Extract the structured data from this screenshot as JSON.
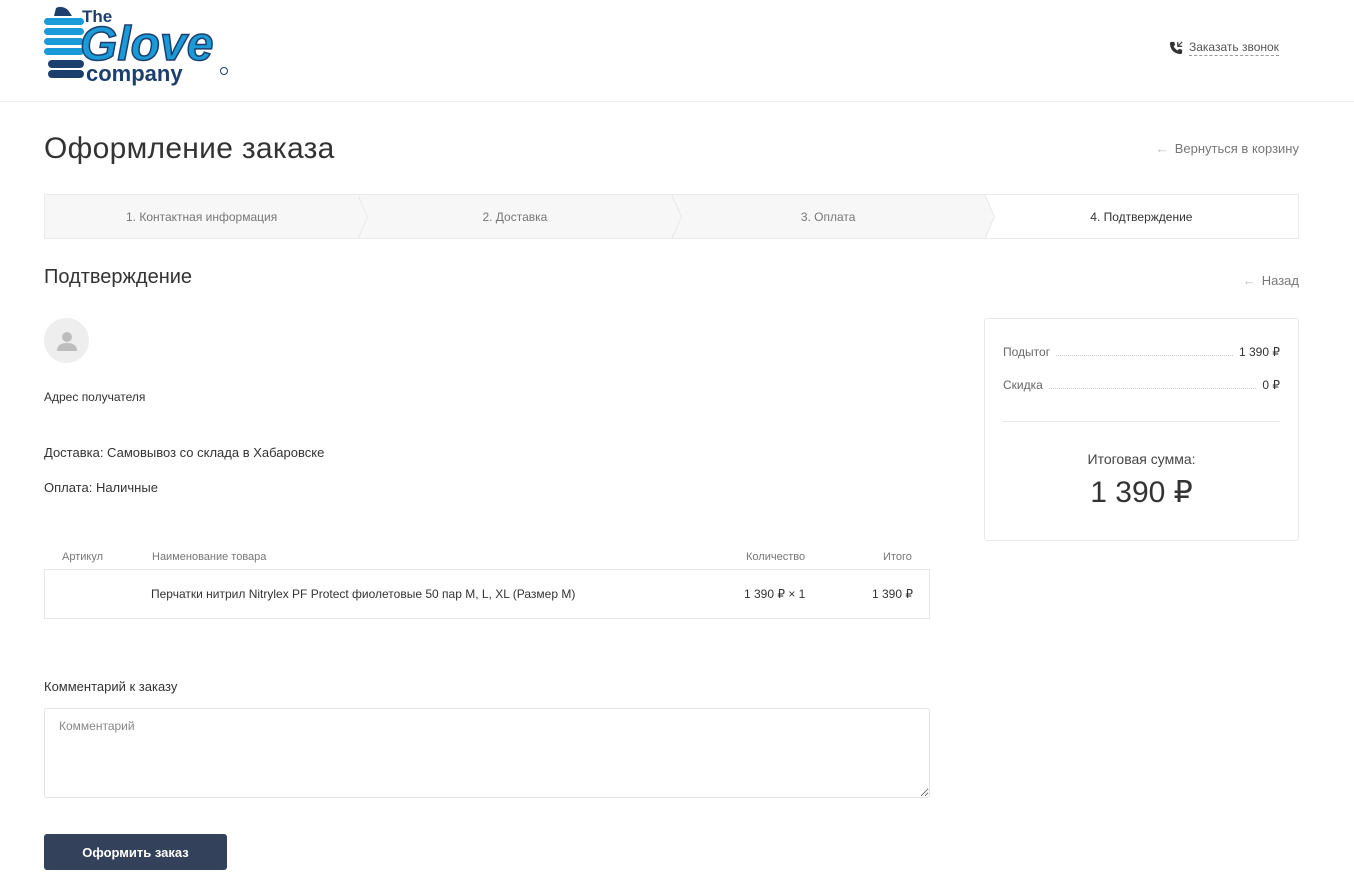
{
  "header": {
    "logo_line1": "The",
    "logo_line2": "Glove",
    "logo_line3": "company",
    "callback_label": "Заказать звонок",
    "brand_color": "#1a9ad6",
    "brand_dark": "#1d3f6e"
  },
  "page": {
    "title": "Оформление заказа",
    "back_to_cart": "Вернуться в корзину"
  },
  "steps": [
    {
      "label": "1. Контактная информация",
      "active": false
    },
    {
      "label": "2. Доставка",
      "active": false
    },
    {
      "label": "3. Оплата",
      "active": false
    },
    {
      "label": "4. Подтверждение",
      "active": true
    }
  ],
  "confirmation": {
    "title": "Подтверждение",
    "back_label": "Назад",
    "address_label": "Адрес получателя",
    "delivery": "Доставка: Самовывоз со склада в Хабаровске",
    "payment": "Оплата: Наличные"
  },
  "table": {
    "headers": {
      "sku": "Артикул",
      "name": "Наименование товара",
      "qty": "Количество",
      "total": "Итого"
    },
    "rows": [
      {
        "sku": "",
        "name": "Перчатки нитрил Nitrylex PF Protect фиолетовые 50 пар M, L, XL (Размер M)",
        "qty": "1 390 ₽ × 1",
        "total": "1 390 ₽"
      }
    ]
  },
  "comment": {
    "label": "Комментарий к заказу",
    "placeholder": "Комментарий",
    "value": ""
  },
  "submit_label": "Оформить заказ",
  "summary": {
    "subtotal_label": "Подытог",
    "subtotal_value": "1 390 ₽",
    "discount_label": "Скидка",
    "discount_value": "0 ₽",
    "total_label": "Итоговая сумма:",
    "total_value": "1 390 ₽"
  },
  "colors": {
    "button": "#33425a",
    "text": "#333333",
    "muted": "#777777"
  }
}
